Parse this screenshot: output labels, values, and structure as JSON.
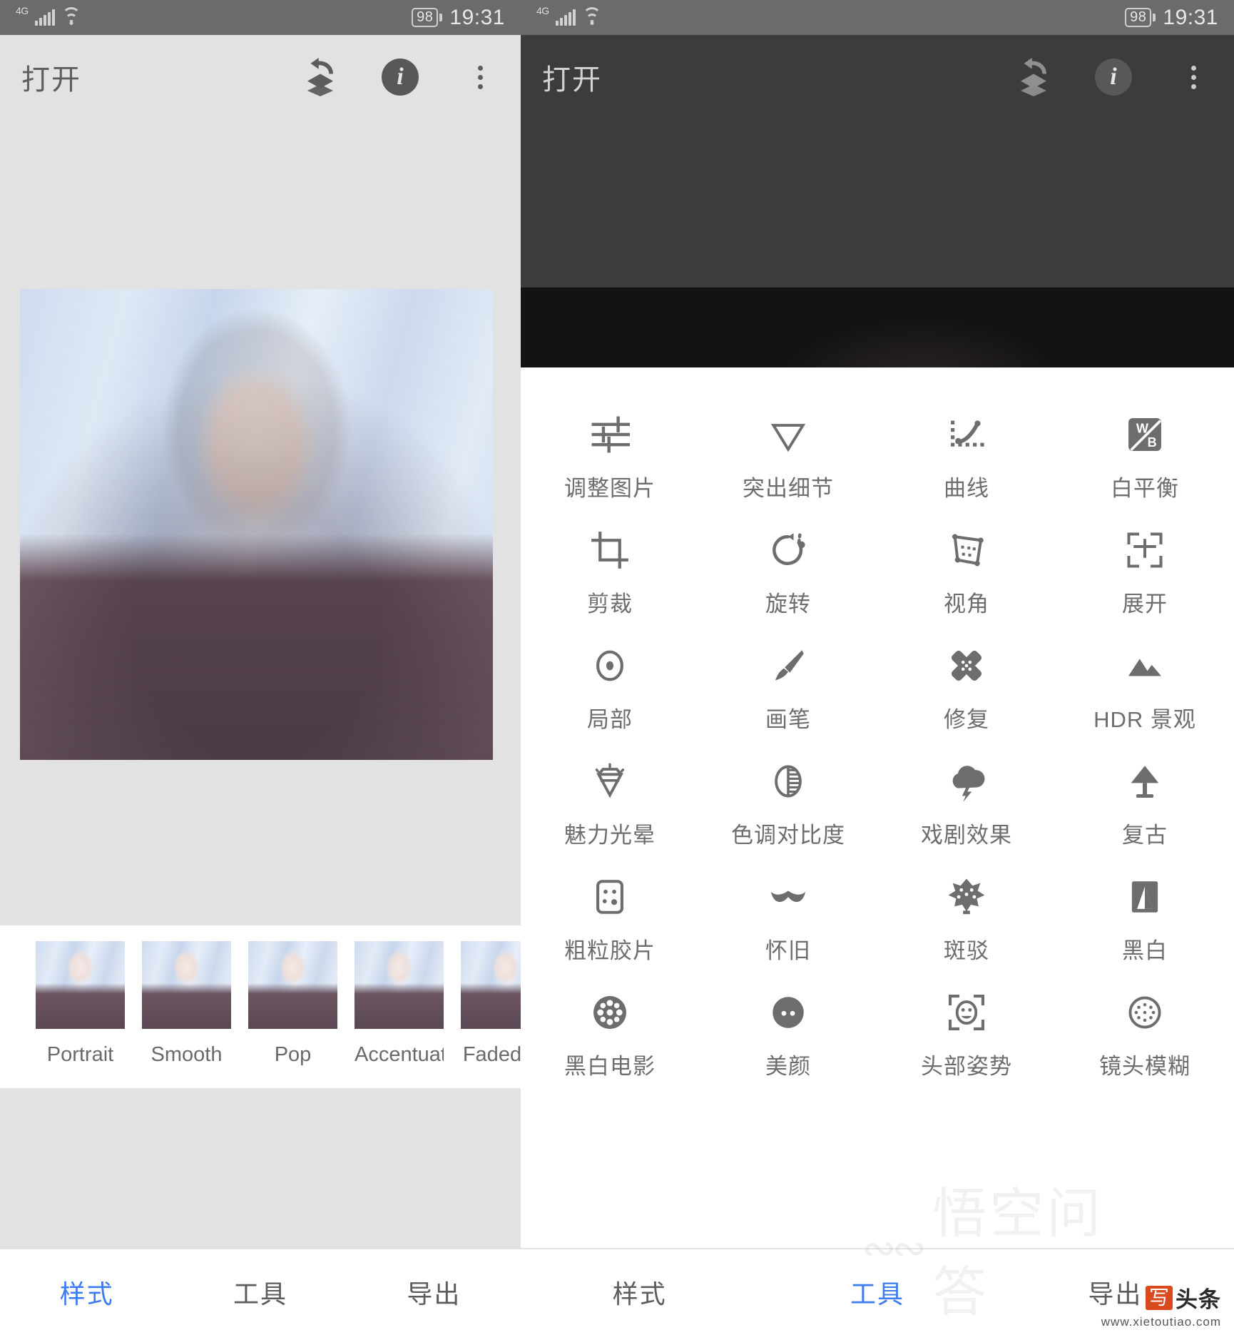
{
  "status_bar": {
    "network": "4G",
    "signal_icon": "signal-bars-icon",
    "wifi_icon": "wifi-icon",
    "battery_level": "98",
    "time": "19:31"
  },
  "left_panel": {
    "toolbar": {
      "title": "打开",
      "undo_icon": "undo-layers-icon",
      "info_icon": "info-icon",
      "menu_icon": "overflow-menu-icon"
    },
    "styles": [
      {
        "label": "Portrait"
      },
      {
        "label": "Smooth"
      },
      {
        "label": "Pop"
      },
      {
        "label": "Accentuate"
      },
      {
        "label": "Faded Gl"
      }
    ],
    "bottom_nav": [
      {
        "label": "样式",
        "active": true
      },
      {
        "label": "工具",
        "active": false
      },
      {
        "label": "导出",
        "active": false
      }
    ]
  },
  "right_panel": {
    "toolbar": {
      "title": "打开",
      "undo_icon": "undo-layers-icon",
      "info_icon": "info-icon",
      "menu_icon": "overflow-menu-icon"
    },
    "tools": [
      {
        "label": "调整图片",
        "icon": "sliders-icon"
      },
      {
        "label": "突出细节",
        "icon": "triangle-down-icon"
      },
      {
        "label": "曲线",
        "icon": "curves-icon"
      },
      {
        "label": "白平衡",
        "icon": "white-balance-icon"
      },
      {
        "label": "剪裁",
        "icon": "crop-icon"
      },
      {
        "label": "旋转",
        "icon": "rotate-icon"
      },
      {
        "label": "视角",
        "icon": "perspective-icon"
      },
      {
        "label": "展开",
        "icon": "expand-icon"
      },
      {
        "label": "局部",
        "icon": "selective-icon"
      },
      {
        "label": "画笔",
        "icon": "brush-icon"
      },
      {
        "label": "修复",
        "icon": "healing-icon"
      },
      {
        "label": "HDR 景观",
        "icon": "hdr-landscape-icon"
      },
      {
        "label": "魅力光晕",
        "icon": "glamour-glow-icon"
      },
      {
        "label": "色调对比度",
        "icon": "tonal-contrast-icon"
      },
      {
        "label": "戏剧效果",
        "icon": "drama-icon"
      },
      {
        "label": "复古",
        "icon": "vintage-lamp-icon"
      },
      {
        "label": "粗粒胶片",
        "icon": "grainy-film-icon"
      },
      {
        "label": "怀旧",
        "icon": "retrolux-moustache-icon"
      },
      {
        "label": "斑驳",
        "icon": "grunge-icon"
      },
      {
        "label": "黑白",
        "icon": "black-white-icon"
      },
      {
        "label": "黑白电影",
        "icon": "noir-film-reel-icon"
      },
      {
        "label": "美颜",
        "icon": "face-beauty-icon"
      },
      {
        "label": "头部姿势",
        "icon": "head-pose-icon"
      },
      {
        "label": "镜头模糊",
        "icon": "lens-blur-icon"
      }
    ],
    "bottom_nav": [
      {
        "label": "样式",
        "active": false
      },
      {
        "label": "工具",
        "active": true
      },
      {
        "label": "导出",
        "active": false
      }
    ],
    "watermarks": {
      "owl_text": "悟空问答",
      "xie_badge": "写",
      "toutiao": "头条",
      "url": "www.xietoutiao.com"
    }
  },
  "colors": {
    "accent_blue": "#3d7bf0",
    "status_bar_bg": "#6b6b6b",
    "left_toolbar_bg": "#e2e2e2",
    "right_toolbar_bg": "#3c3c3c",
    "icon_gray": "#6d6d6d"
  }
}
